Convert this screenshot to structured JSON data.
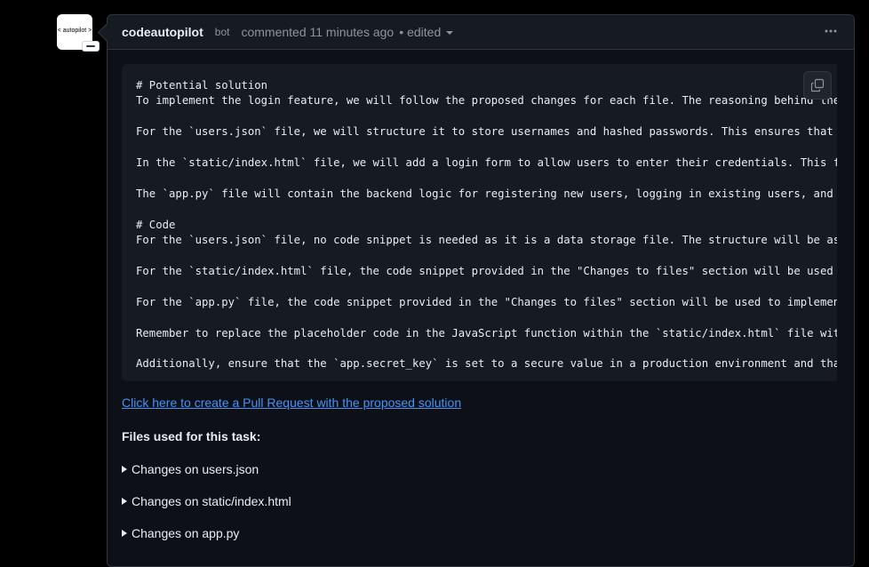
{
  "avatar": {
    "text": "< autopilot >"
  },
  "comment": {
    "author": "codeautopilot",
    "badge": "bot",
    "meta": "commented 11 minutes ago",
    "separator": "•",
    "edited": "edited",
    "menu_icon": "kebab-horizontal-icon"
  },
  "code": {
    "lines": [
      "# Potential solution",
      "To implement the login feature, we will follow the proposed changes for each file. The reasoning behind the so",
      "",
      "For the `users.json` file, we will structure it to store usernames and hashed passwords. This ensures that ever",
      "",
      "In the `static/index.html` file, we will add a login form to allow users to enter their credentials. This form",
      "",
      "The `app.py` file will contain the backend logic for registering new users, logging in existing users, and mana",
      "",
      "# Code",
      "For the `users.json` file, no code snippet is needed as it is a data storage file. The structure will be as des",
      "",
      "For the `static/index.html` file, the code snippet provided in the \"Changes to files\" section will be used to a",
      "",
      "For the `app.py` file, the code snippet provided in the \"Changes to files\" section will be used to implement th",
      "",
      "Remember to replace the placeholder code in the JavaScript function within the `static/index.html` file with ac",
      "",
      "Additionally, ensure that the `app.secret_key` is set to a secure value in a production environment and that th"
    ],
    "copy_icon": "copy-icon"
  },
  "pr_link": "Click here to create a Pull Request with the proposed solution",
  "files_heading": "Files used for this task:",
  "files": [
    "Changes on users.json",
    "Changes on static/index.html",
    "Changes on app.py"
  ]
}
